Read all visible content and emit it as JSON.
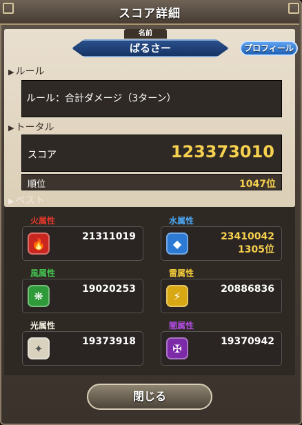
{
  "window": {
    "title": "スコア詳細"
  },
  "player": {
    "name_tab": "名前",
    "name": "ばるさー",
    "profile_label": "プロフィール"
  },
  "rule": {
    "section": "ルール",
    "text": "ルール：合計ダメージ（3ターン）"
  },
  "total": {
    "section": "トータル",
    "score_label": "スコア",
    "score_value": "123373010",
    "rank_label": "順位",
    "rank_value": "1047位"
  },
  "best": {
    "section": "ベスト",
    "elements": [
      {
        "label": "火属性",
        "value": "21311019",
        "rank": "",
        "color": "#e2372b",
        "icon": "fire-icon"
      },
      {
        "label": "水属性",
        "value": "23410042",
        "rank": "1305位",
        "color": "#4aa8f5",
        "icon": "water-icon"
      },
      {
        "label": "風属性",
        "value": "19020253",
        "rank": "",
        "color": "#43c04f",
        "icon": "wind-icon"
      },
      {
        "label": "雷属性",
        "value": "20886836",
        "rank": "",
        "color": "#f0c93a",
        "icon": "lightning-icon"
      },
      {
        "label": "光属性",
        "value": "19373918",
        "rank": "",
        "color": "#f3eee0",
        "icon": "light-icon"
      },
      {
        "label": "闇属性",
        "value": "19370942",
        "rank": "",
        "color": "#b04be0",
        "icon": "dark-icon"
      }
    ]
  },
  "close_label": "閉じる"
}
